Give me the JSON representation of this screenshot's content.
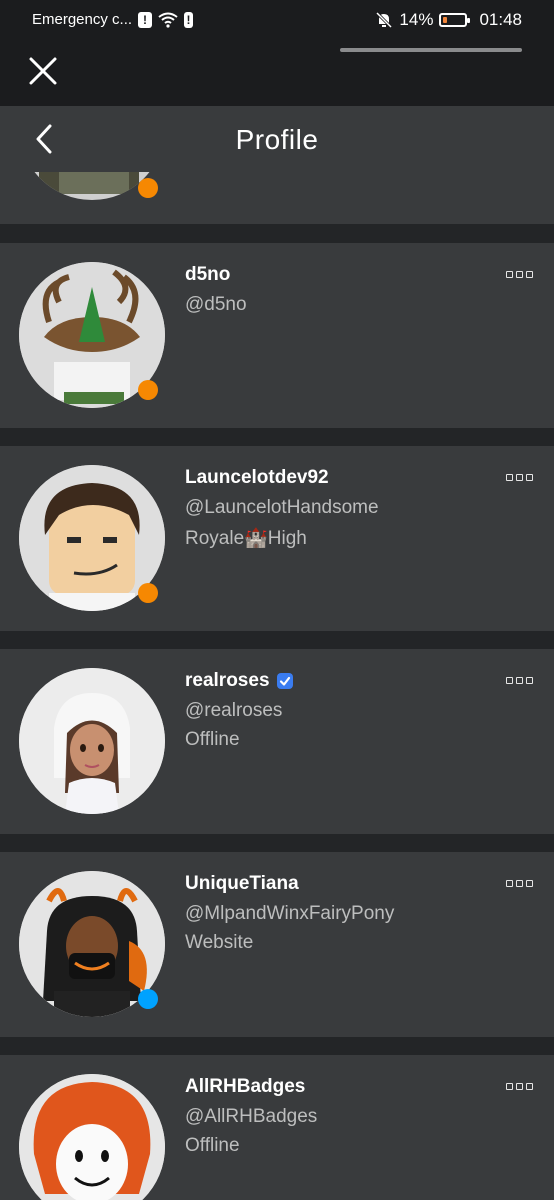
{
  "status_bar": {
    "carrier": "Emergency c...",
    "battery": "14%",
    "time": "01:48"
  },
  "header": {
    "title": "Profile"
  },
  "profiles": [
    {
      "name": "d5no",
      "handle": "@d5no",
      "status": "",
      "verified": false
    },
    {
      "name": "Launcelotdev92",
      "handle": "@LauncelotHandsome",
      "status": "Royale🏰High",
      "verified": false
    },
    {
      "name": "realroses",
      "handle": "@realroses",
      "status": "Offline",
      "verified": true
    },
    {
      "name": "UniqueTiana",
      "handle": "@MlpandWinxFairyPony",
      "status": "Website",
      "verified": false
    },
    {
      "name": "AllRHBadges",
      "handle": "@AllRHBadges",
      "status": "Offline",
      "verified": false
    }
  ],
  "colors": {
    "ingame": "#f68802",
    "online": "#00a2ff",
    "background": "#232527",
    "card": "#393b3d"
  }
}
